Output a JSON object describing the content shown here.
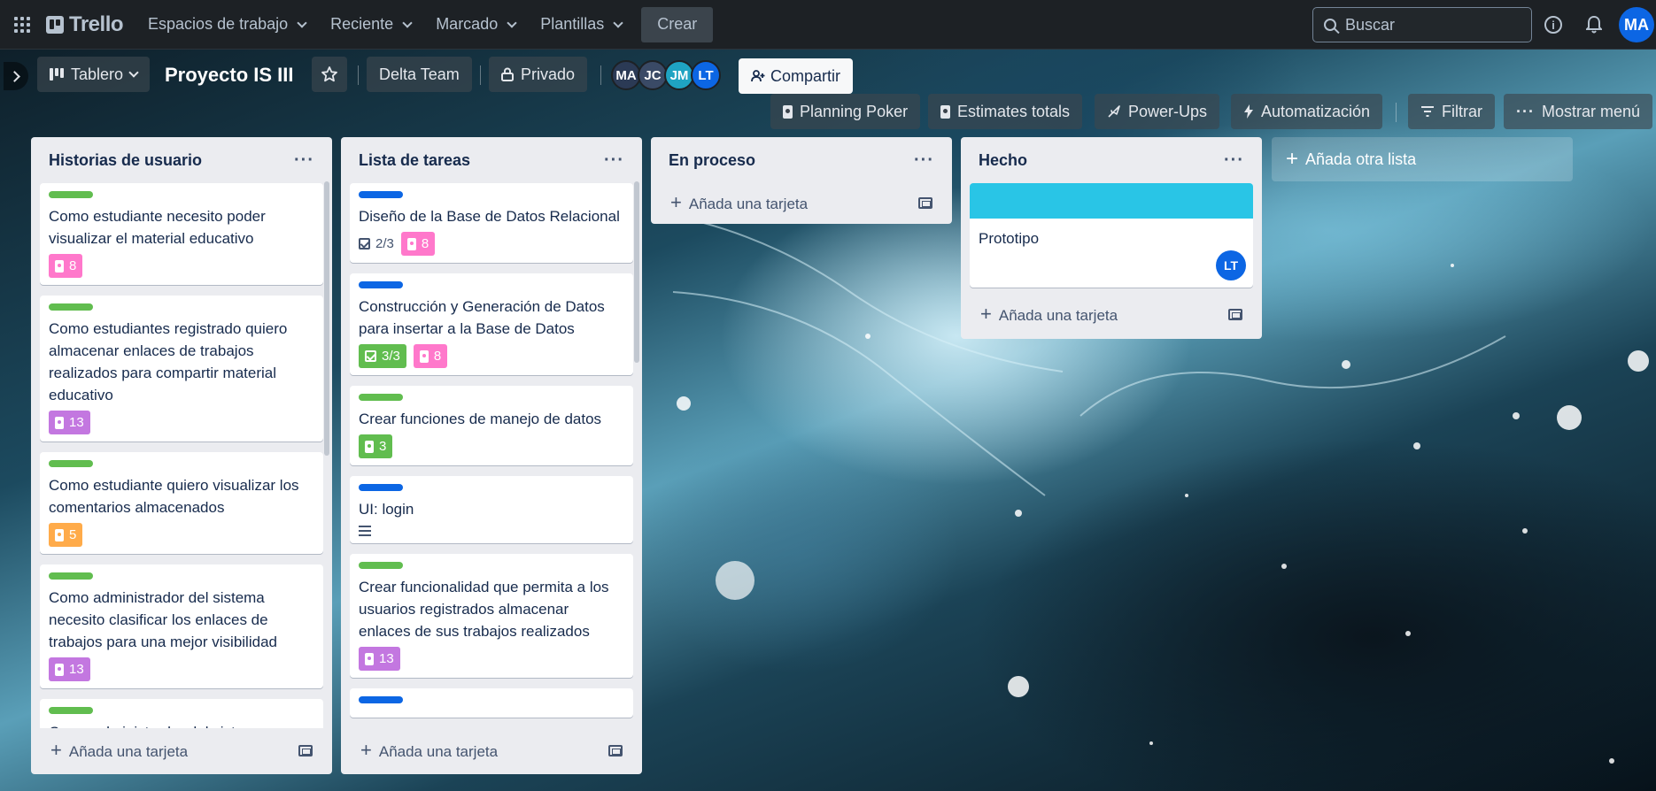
{
  "nav": {
    "logo": "Trello",
    "items": [
      "Espacios de trabajo",
      "Reciente",
      "Marcado",
      "Plantillas"
    ],
    "create": "Crear",
    "search_placeholder": "Buscar",
    "user_initials": "MA"
  },
  "board": {
    "view": "Tablero",
    "title": "Proyecto IS III",
    "workspace": "Delta Team",
    "visibility": "Privado",
    "members": [
      {
        "initials": "MA",
        "color": "#2b3a55"
      },
      {
        "initials": "JC",
        "color": "#3a4a66"
      },
      {
        "initials": "JM",
        "color": "#1fa3c2"
      },
      {
        "initials": "LT",
        "color": "#0c66e4"
      }
    ],
    "share": "Compartir",
    "powerups": [
      "Planning Poker",
      "Estimates totals",
      "Power-Ups",
      "Automatización"
    ],
    "filter": "Filtrar",
    "menu": "Mostrar menú"
  },
  "colors": {
    "green": "#61bd4f",
    "blue": "#0c66e4",
    "pink": "#ff78cb",
    "purple": "#c377e0",
    "orange": "#ffab4a",
    "greenBadge": "#61bd4f"
  },
  "lists": [
    {
      "title": "Historias de usuario",
      "add_card": "Añada una tarjeta",
      "cards": [
        {
          "label": "green",
          "title": "Como estudiante necesito poder visualizar el material educativo",
          "estimate": "8",
          "estimate_color": "pink"
        },
        {
          "label": "green",
          "title": "Como estudiantes registrado quiero almacenar enlaces de trabajos realizados para compartir material educativo",
          "estimate": "13",
          "estimate_color": "purple"
        },
        {
          "label": "green",
          "title": "Como estudiante quiero visualizar los comentarios almacenados",
          "estimate": "5",
          "estimate_color": "orange"
        },
        {
          "label": "green",
          "title": "Como administrador del sistema necesito clasificar los enlaces de trabajos para una mejor visibilidad",
          "estimate": "13",
          "estimate_color": "purple"
        },
        {
          "label": "green",
          "title": "Como administrador del sistema",
          "estimate": "",
          "estimate_color": ""
        }
      ]
    },
    {
      "title": "Lista de tareas",
      "add_card": "Añada una tarjeta",
      "cards": [
        {
          "label": "blue",
          "title": "Diseño de la Base de Datos Relacional",
          "checklist": "2/3",
          "estimate": "8",
          "estimate_color": "pink"
        },
        {
          "label": "blue",
          "title": "Construcción y Generación de Datos para insertar a la Base de Datos",
          "checklist": "3/3",
          "checklist_done": true,
          "estimate": "8",
          "estimate_color": "pink"
        },
        {
          "label": "green",
          "title": "Crear funciones de manejo de datos",
          "estimate": "3",
          "estimate_color": "greenBadge"
        },
        {
          "label": "blue",
          "title": "UI: login",
          "description": true
        },
        {
          "label": "green",
          "title": "Crear funcionalidad que permita a los usuarios registrados almacenar enlaces de sus trabajos realizados",
          "estimate": "13",
          "estimate_color": "purple"
        },
        {
          "label": "blue",
          "title": ""
        }
      ]
    },
    {
      "title": "En proceso",
      "add_card": "Añada una tarjeta",
      "cards": []
    },
    {
      "title": "Hecho",
      "add_card": "Añada una tarjeta",
      "cards": [
        {
          "cover": "#29c5e6",
          "title": "Prototipo",
          "member": "LT"
        }
      ]
    }
  ],
  "add_list": "Añada otra lista"
}
